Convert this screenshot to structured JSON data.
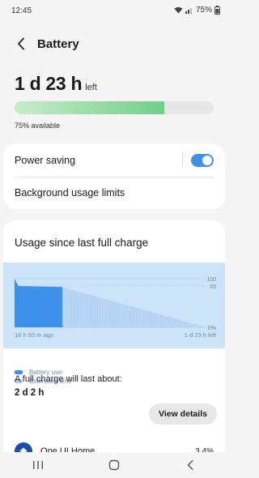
{
  "status_bar": {
    "time": "12:45",
    "battery_pct": "75%"
  },
  "header": {
    "title": "Battery"
  },
  "battery": {
    "remaining": "1 d 23 h",
    "remaining_suffix": "left",
    "level_fraction": 0.75,
    "available_text": "75% available"
  },
  "settings": {
    "power_saving_label": "Power saving",
    "power_saving_on": true,
    "background_limits_label": "Background usage limits"
  },
  "usage": {
    "title": "Usage since last full charge",
    "full_charge_label": "A full charge will last about:",
    "full_charge_value": "2 d 2 h",
    "view_details_label": "View details",
    "first_app": {
      "name": "One UI Home",
      "pct": "3.4%"
    }
  },
  "chart_data": {
    "type": "area",
    "series": [
      {
        "name": "Battery use",
        "points": [
          [
            0,
            100
          ],
          [
            0.02,
            85
          ],
          [
            0.25,
            83
          ]
        ]
      },
      {
        "name": "Estimated time",
        "points": [
          [
            0.25,
            83
          ],
          [
            1.0,
            0
          ]
        ]
      }
    ],
    "y_ticks": [
      "100",
      "85",
      "0%"
    ],
    "x_labels": [
      "16 h 50 m ago",
      "1 d 23 h left"
    ],
    "ylim": [
      0,
      100
    ],
    "legend": [
      "Battery use",
      "Estimated time"
    ],
    "colors": {
      "used": "#3e91e8",
      "estimated": "#a9cdf2",
      "background": "#cde3f8"
    }
  },
  "nav": {
    "recent_icon": "recent-apps-icon",
    "home_icon": "home-icon",
    "back_icon": "back-icon"
  }
}
